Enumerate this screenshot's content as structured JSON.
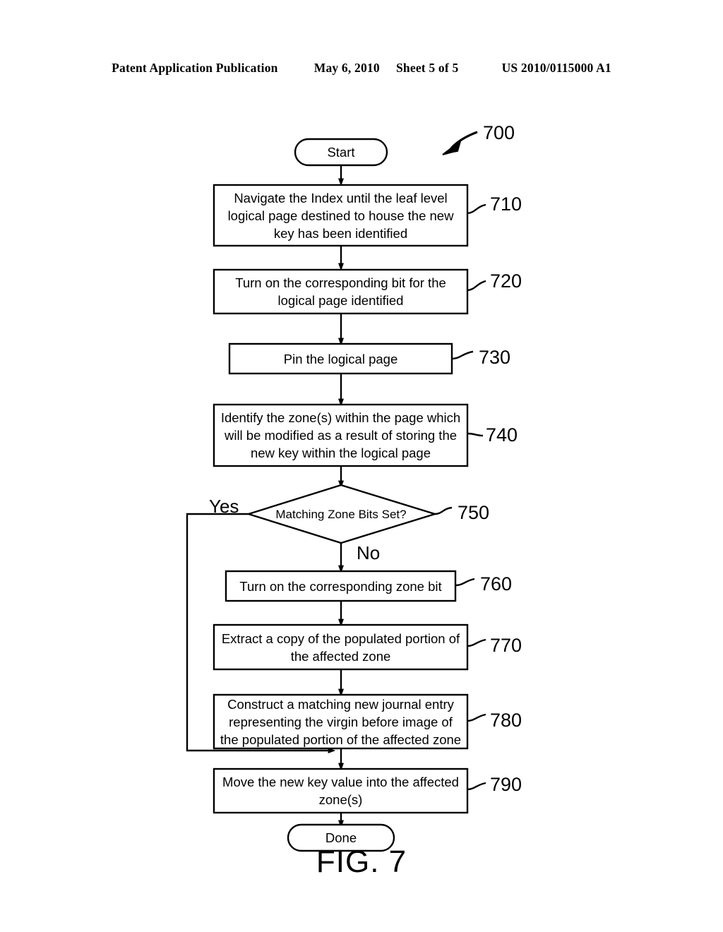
{
  "header": {
    "publication": "Patent Application Publication",
    "date": "May 6, 2010",
    "sheet": "Sheet 5 of 5",
    "patent_number": "US 2010/0115000 A1"
  },
  "figure": {
    "caption": "FIG. 7",
    "diagram_ref": "700",
    "nodes": [
      {
        "id": "start",
        "type": "terminal",
        "text": "Start"
      },
      {
        "id": "n710",
        "type": "process",
        "ref": "710",
        "lines": [
          "Navigate the Index until the leaf level",
          "logical page destined to house the new",
          "key has been identified"
        ]
      },
      {
        "id": "n720",
        "type": "process",
        "ref": "720",
        "lines": [
          "Turn on the corresponding bit for the",
          "logical page identified"
        ]
      },
      {
        "id": "n730",
        "type": "process",
        "ref": "730",
        "lines": [
          "Pin the logical page"
        ]
      },
      {
        "id": "n740",
        "type": "process",
        "ref": "740",
        "lines": [
          "Identify the zone(s) within the page which",
          "will be modified as a result of storing the",
          "new key within the logical page"
        ]
      },
      {
        "id": "n750",
        "type": "decision",
        "ref": "750",
        "lines": [
          "Matching Zone Bits Set?"
        ]
      },
      {
        "id": "n760",
        "type": "process",
        "ref": "760",
        "lines": [
          "Turn on the corresponding zone bit"
        ]
      },
      {
        "id": "n770",
        "type": "process",
        "ref": "770",
        "lines": [
          "Extract a copy of the populated portion of",
          "the affected zone"
        ]
      },
      {
        "id": "n780",
        "type": "process",
        "ref": "780",
        "lines": [
          "Construct a matching new journal entry",
          "representing the virgin before image of",
          "the populated portion of the affected zone"
        ]
      },
      {
        "id": "n790",
        "type": "process",
        "ref": "790",
        "lines": [
          "Move the new key value into the affected",
          "zone(s)"
        ]
      },
      {
        "id": "done",
        "type": "terminal",
        "text": "Done"
      }
    ],
    "branch_labels": {
      "yes": "Yes",
      "no": "No"
    },
    "colors": {
      "stroke": "#000000",
      "fill": "#ffffff",
      "text": "#000000"
    }
  }
}
